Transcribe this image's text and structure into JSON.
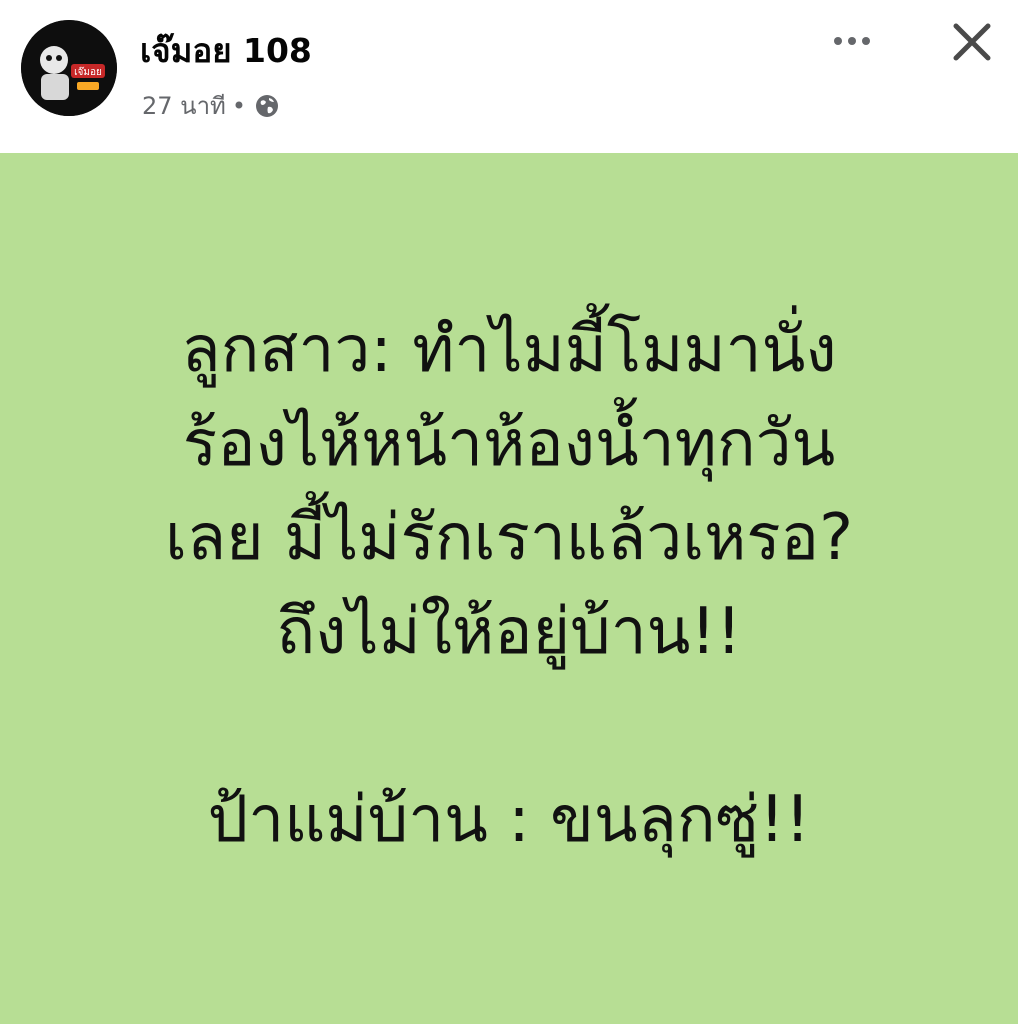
{
  "header": {
    "author_name": "เจ๊มอย 108",
    "time_ago": "27 นาที",
    "separator": "•",
    "privacy_icon": "globe-icon",
    "more_icon": "more-options-icon",
    "close_icon": "close-icon",
    "avatar_text": "เจ๊มอย"
  },
  "post": {
    "background_color": "#b7de94",
    "lines": [
      "ลูกสาว: ทำไมมี้โมมานั่ง",
      "ร้องไห้หน้าห้องน้ำทุกวัน",
      "เลย มี้ไม่รักเราแล้วเหรอ?",
      "ถึงไม่ให้อยู่บ้าน!!",
      "ป้าแม่บ้าน : ขนลุกซู่!!"
    ]
  }
}
